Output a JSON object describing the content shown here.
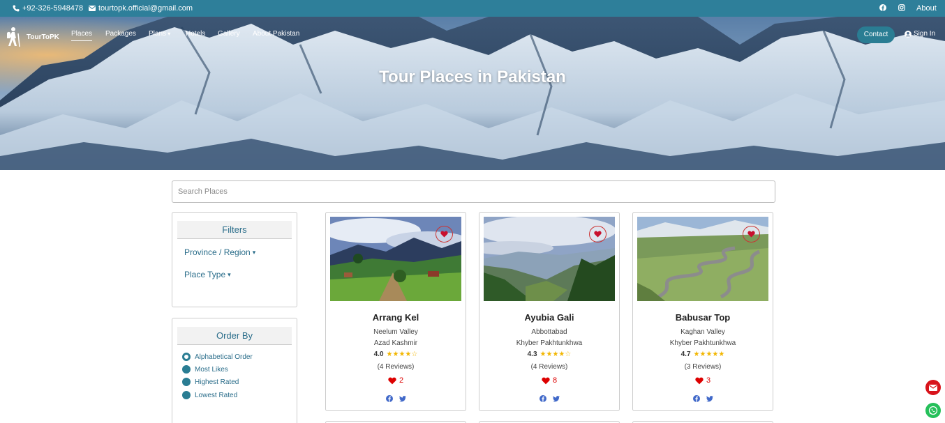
{
  "topbar": {
    "phone": "+92-326-5948478",
    "email": "tourtopk.official@gmail.com",
    "social_icons": [
      "facebook-icon",
      "instagram-icon"
    ],
    "about_label": "About"
  },
  "nav": {
    "brand": "TourToPK",
    "links": [
      "Places",
      "Packages",
      "Plans",
      "Hotels",
      "Gallery",
      "About Pakistan"
    ],
    "active": "Places",
    "contact_label": "Contact",
    "signin_label": "Sign In"
  },
  "hero": {
    "title": "Tour Places in Pakistan"
  },
  "search": {
    "placeholder": "Search Places"
  },
  "filters": {
    "heading": "Filters",
    "province_label": "Province / Region",
    "type_label": "Place Type"
  },
  "order_by": {
    "heading": "Order By",
    "options": [
      "Alphabetical Order",
      "Most Likes",
      "Highest Rated",
      "Lowest Rated"
    ],
    "selected": "Alphabetical Order"
  },
  "places": [
    {
      "name": "Arrang Kel",
      "area": "Neelum Valley",
      "region": "Azad Kashmir",
      "rating": "4.0",
      "stars": "★★★★☆",
      "reviews": "(4 Reviews)",
      "likes": "2"
    },
    {
      "name": "Ayubia Gali",
      "area": "Abbottabad",
      "region": "Khyber Pakhtunkhwa",
      "rating": "4.3",
      "stars": "★★★★☆",
      "reviews": "(4 Reviews)",
      "likes": "8"
    },
    {
      "name": "Babusar Top",
      "area": "Kaghan Valley",
      "region": "Khyber Pakhtunkhwa",
      "rating": "4.7",
      "stars": "★★★★★",
      "reviews": "(3 Reviews)",
      "likes": "3"
    }
  ],
  "colors": {
    "primary": "#2e7f9a",
    "link": "#2a6d8a",
    "like": "#dd0000",
    "star": "#f2b600"
  }
}
